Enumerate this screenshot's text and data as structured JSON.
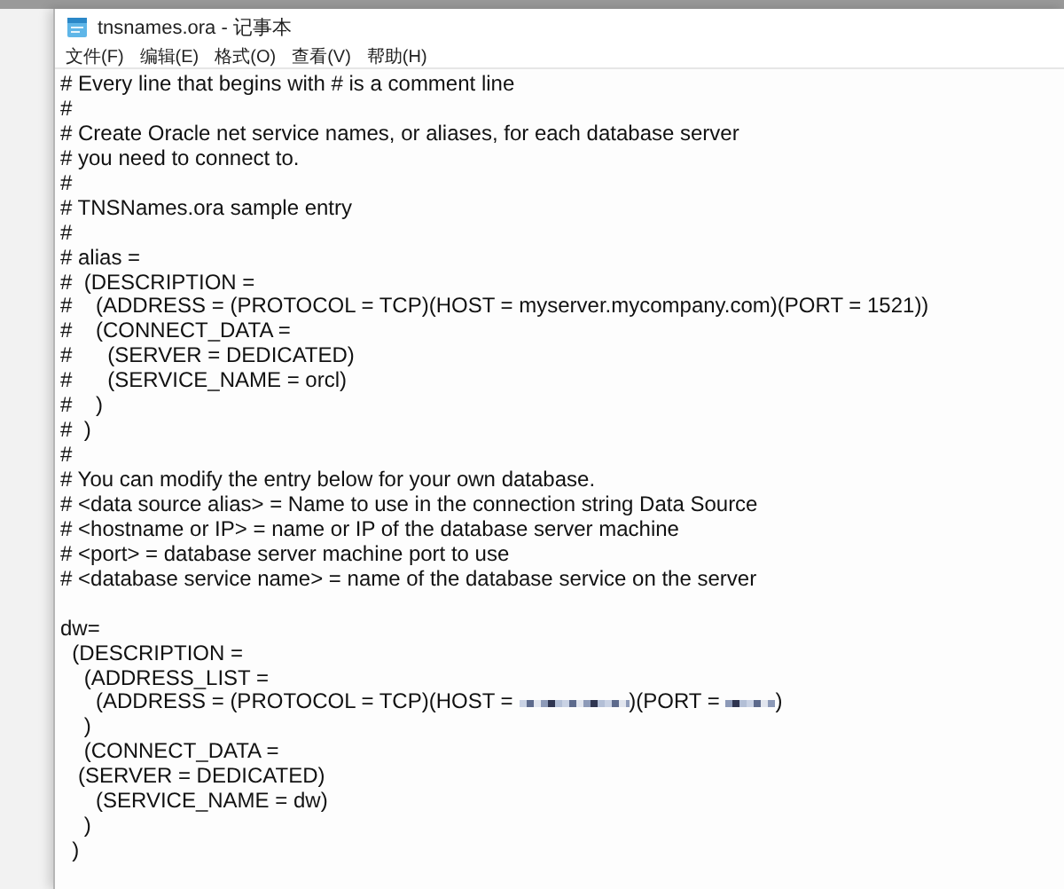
{
  "window": {
    "title": "tnsnames.ora - 记事本"
  },
  "menu": [
    "文件(F)",
    "编辑(E)",
    "格式(O)",
    "查看(V)",
    "帮助(H)"
  ],
  "lines": [
    {
      "kind": "text",
      "text": "# Every line that begins with # is a comment line"
    },
    {
      "kind": "text",
      "text": "#"
    },
    {
      "kind": "text",
      "text": "# Create Oracle net service names, or aliases, for each database server"
    },
    {
      "kind": "text",
      "text": "# you need to connect to."
    },
    {
      "kind": "text",
      "text": "#"
    },
    {
      "kind": "text",
      "text": "# TNSNames.ora sample entry"
    },
    {
      "kind": "text",
      "text": "#"
    },
    {
      "kind": "text",
      "text": "# alias ="
    },
    {
      "kind": "text",
      "text": "#  (DESCRIPTION ="
    },
    {
      "kind": "text",
      "text": "#    (ADDRESS = (PROTOCOL = TCP)(HOST = myserver.mycompany.com)(PORT = 1521))"
    },
    {
      "kind": "text",
      "text": "#    (CONNECT_DATA ="
    },
    {
      "kind": "text",
      "text": "#      (SERVER = DEDICATED)"
    },
    {
      "kind": "text",
      "text": "#      (SERVICE_NAME = orcl)"
    },
    {
      "kind": "text",
      "text": "#    )"
    },
    {
      "kind": "text",
      "text": "#  )"
    },
    {
      "kind": "text",
      "text": "#"
    },
    {
      "kind": "text",
      "text": "# You can modify the entry below for your own database."
    },
    {
      "kind": "text",
      "text": "# <data source alias> = Name to use in the connection string Data Source"
    },
    {
      "kind": "text",
      "text": "# <hostname or IP> = name or IP of the database server machine"
    },
    {
      "kind": "text",
      "text": "# <port> = database server machine port to use"
    },
    {
      "kind": "text",
      "text": "# <database service name> = name of the database service on the server"
    },
    {
      "kind": "blank"
    },
    {
      "kind": "text",
      "text": "dw="
    },
    {
      "kind": "text",
      "text": "  (DESCRIPTION ="
    },
    {
      "kind": "text",
      "text": "    (ADDRESS_LIST ="
    },
    {
      "kind": "parts",
      "parts": [
        {
          "kind": "text",
          "text": "      (ADDRESS = (PROTOCOL = TCP)(HOST = "
        },
        {
          "kind": "redacted"
        },
        {
          "kind": "text",
          "text": ")(PORT = "
        },
        {
          "kind": "redacted"
        },
        {
          "kind": "text",
          "text": ")"
        }
      ]
    },
    {
      "kind": "text",
      "text": "    )"
    },
    {
      "kind": "text",
      "text": "    (CONNECT_DATA ="
    },
    {
      "kind": "text",
      "text": "   (SERVER = DEDICATED)"
    },
    {
      "kind": "text",
      "text": "      (SERVICE_NAME = dw)"
    },
    {
      "kind": "text",
      "text": "    )"
    },
    {
      "kind": "text",
      "text": "  )"
    }
  ]
}
